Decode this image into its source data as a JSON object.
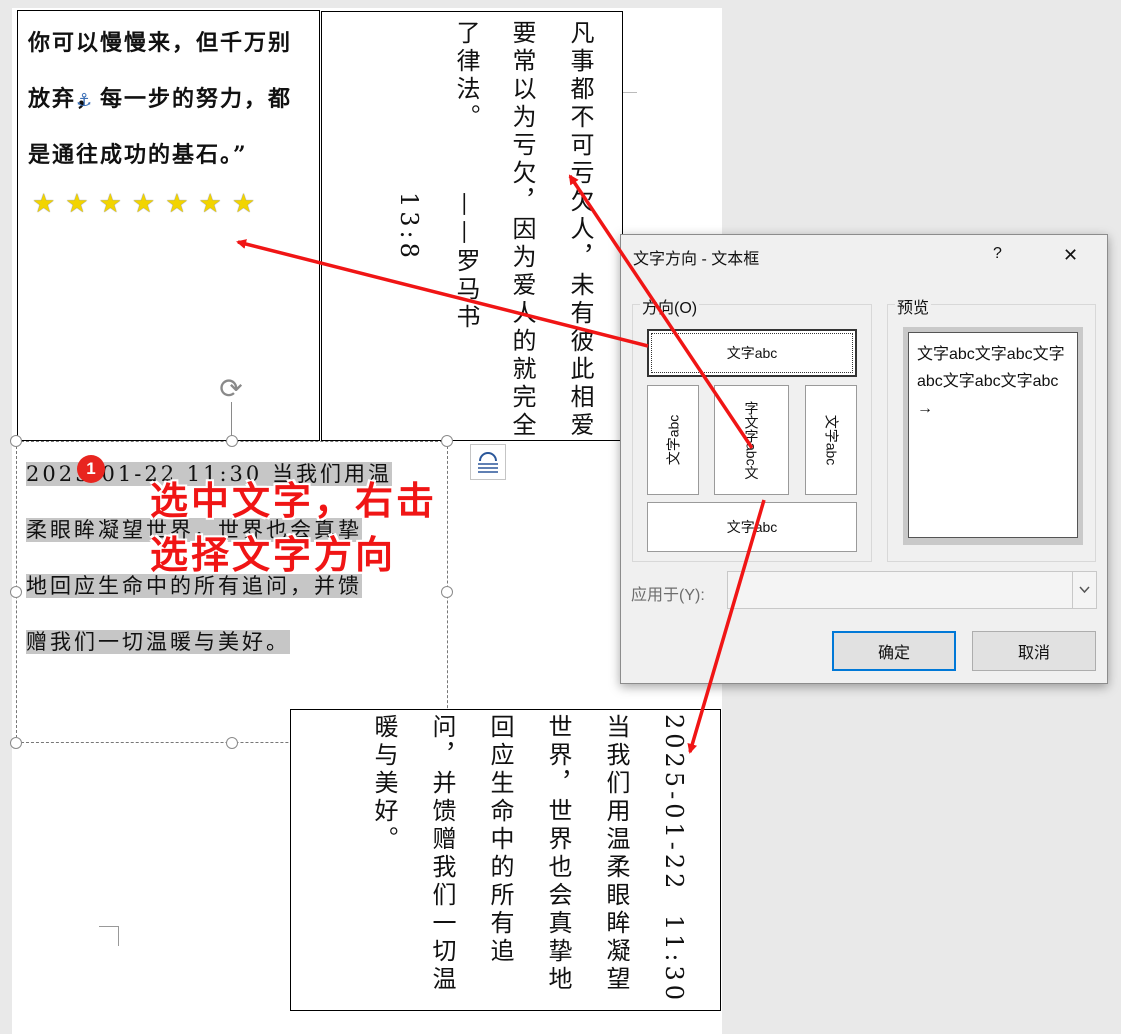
{
  "textbox_top_left": {
    "lines": [
      "你可以慢慢来，但千万别",
      "放弃，每一步的努力，都",
      "是通往成功的基石。”"
    ],
    "stars": "★★★★★★★"
  },
  "textbox_top_right": {
    "columns": [
      "凡事都不可亏欠人，未有彼此相爱",
      "要常以为亏欠，因为爱人的就完全",
      "了律法。"
    ],
    "citation": "——罗马书13:8"
  },
  "selected_textbox": {
    "badge": "1",
    "lines": [
      "2025-01-22 11:30 当我们用温",
      "柔眼眸凝望世界，世界也会真挚",
      "地回应生命中的所有追问，并馈",
      "赠我们一切温暖与美好。"
    ]
  },
  "annotation": {
    "line1": "选中文字，右击",
    "line2": "选择文字方向"
  },
  "result_textbox": {
    "columns": [
      "2025-01-22 11:30",
      "当我们用温柔眼眸凝望",
      "世界，世界也会真挚地",
      "回应生命中的所有追",
      "问，并馈赠我们一切温",
      "暖与美好。"
    ]
  },
  "dialog": {
    "title": "文字方向 - 文本框",
    "help_label": "?",
    "close_label": "✕",
    "direction_group_label": "方向(O)",
    "preview_group_label": "预览",
    "options": [
      "文字abc",
      "文字abc",
      "字文字abc文",
      "文字abc",
      "文字abc"
    ],
    "preview_text": "文字abc文字abc文字abc文字abc文字abc→",
    "apply_label": "应用于(Y):",
    "apply_value": "",
    "ok_label": "确定",
    "cancel_label": "取消"
  },
  "colors": {
    "annotation_red": "#f01515",
    "selection_gray": "#c6c6c6",
    "badge_red": "#e8251f"
  }
}
